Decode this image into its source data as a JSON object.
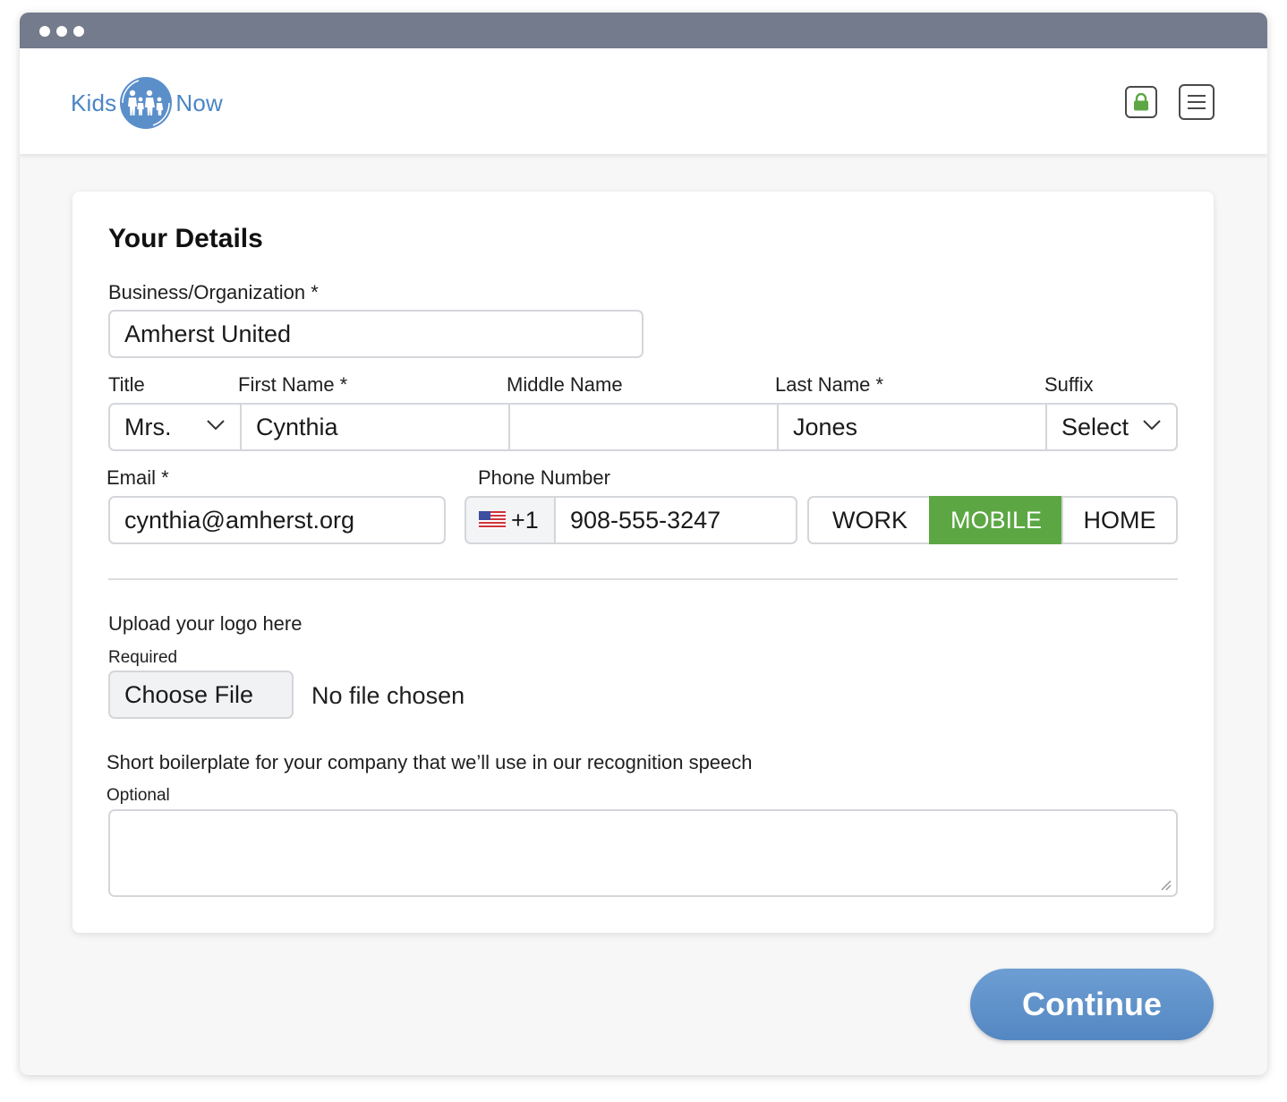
{
  "logo": {
    "left_text": "Kids",
    "right_text": "Now",
    "icon": "family-icon"
  },
  "header": {
    "lock_icon": "lock-icon",
    "menu_icon": "menu-icon"
  },
  "form": {
    "heading": "Your Details",
    "business": {
      "label": "Business/Organization *",
      "value": "Amherst United"
    },
    "title": {
      "label": "Title",
      "value": "Mrs."
    },
    "first_name": {
      "label": "First Name *",
      "value": "Cynthia"
    },
    "middle_name": {
      "label": "Middle Name",
      "value": ""
    },
    "last_name": {
      "label": "Last Name *",
      "value": "Jones"
    },
    "suffix": {
      "label": "Suffix",
      "value": "Select"
    },
    "email": {
      "label": "Email *",
      "value": "cynthia@amherst.org"
    },
    "phone": {
      "label": "Phone Number",
      "country_code": "+1",
      "country_flag": "us-flag-icon",
      "value": "908-555-3247",
      "types": [
        "WORK",
        "MOBILE",
        "HOME"
      ],
      "selected_type": "MOBILE"
    },
    "upload": {
      "label": "Upload your logo here",
      "sublabel": "Required",
      "button": "Choose File",
      "status": "No file chosen"
    },
    "boilerplate": {
      "label": "Short boilerplate for your company that we’ll use in our recognition speech",
      "sublabel": "Optional",
      "value": ""
    }
  },
  "continue_label": "Continue",
  "colors": {
    "accent_blue": "#4b86c5",
    "selected_green": "#5ca744",
    "titlebar": "#737b8c"
  }
}
